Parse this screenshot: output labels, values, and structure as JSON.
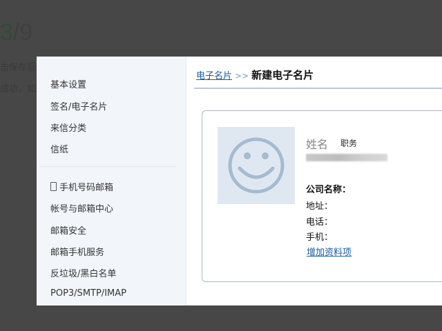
{
  "background": {
    "step_current": "3",
    "step_total": "/9",
    "line1": "击保存后",
    "line2": "成功，如"
  },
  "sidebar": {
    "group1": [
      "基本设置",
      "签名/电子名片",
      "来信分类",
      "信纸"
    ],
    "group2": [
      "手机号码邮箱",
      "帐号与邮箱中心",
      "邮箱安全",
      "邮箱手机服务",
      "反垃圾/黑白名单",
      "POP3/SMTP/IMAP"
    ]
  },
  "breadcrumb": {
    "parent": "电子名片",
    "separator": ">>",
    "current": "新建电子名片"
  },
  "card": {
    "avatar_icon": "smiley-face-icon",
    "name_placeholder": "姓名",
    "title_placeholder": "职务",
    "company_label": "公司名称：",
    "address_label": "地址：",
    "phone_label": "电话：",
    "mobile_label": "手机：",
    "add_field_link": "增加资料项"
  }
}
